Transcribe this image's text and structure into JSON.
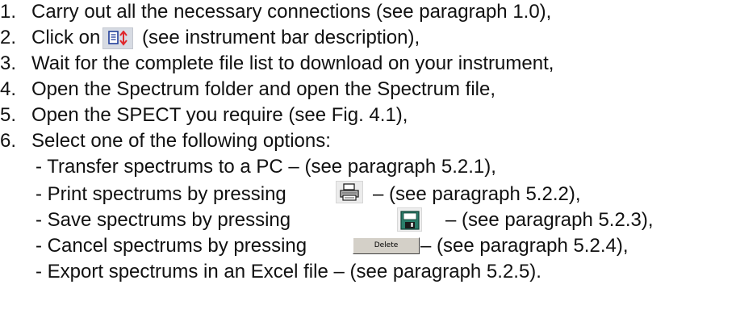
{
  "steps": [
    {
      "number": "1.",
      "text": "Carry out all the necessary connections (see paragraph 1.0),"
    },
    {
      "number": "2.",
      "before_icon": "Click on",
      "after_icon": "(see instrument bar description),",
      "icon": "download-file-list-icon"
    },
    {
      "number": "3.",
      "text": "Wait for the complete file list to download on your instrument,"
    },
    {
      "number": "4.",
      "text": "Open the Spectrum folder and open the Spectrum file,"
    },
    {
      "number": "5.",
      "text": "Open the SPECT you require (see Fig. 4.1),"
    },
    {
      "number": "6.",
      "text": "Select one of the following options:"
    }
  ],
  "options": [
    {
      "text": "- Transfer spectrums to a PC – (see paragraph 5.2.1),"
    },
    {
      "before_icon": "- Print spectrums by pressing",
      "after_icon": "– (see paragraph 5.2.2),",
      "icon": "printer-icon"
    },
    {
      "before_icon": "- Save spectrums by pressing",
      "after_icon": "– (see paragraph 5.2.3),",
      "icon": "floppy-disk-icon"
    },
    {
      "before_icon": "- Cancel spectrums by pressing",
      "button_label": "Delete",
      "after_icon": "– (see paragraph 5.2.4),"
    },
    {
      "text": "- Export spectrums in an Excel file  – (see paragraph 5.2.5)."
    }
  ],
  "colors": {
    "text": "#111111",
    "icon_blue": "#1f3d9a",
    "icon_red": "#e0282c",
    "floppy_green": "#2a7d6a",
    "button_face": "#d4d0c8"
  }
}
